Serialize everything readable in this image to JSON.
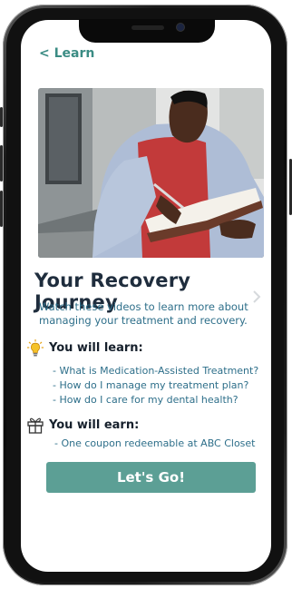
{
  "nav": {
    "back_label": "< Learn"
  },
  "content": {
    "title": "Your Recovery Journey",
    "subtitle": "Watch these videos to learn more about managing your treatment and recovery.",
    "learn": {
      "heading": "You will learn:",
      "icon": "lightbulb-icon",
      "items": [
        "- What is Medication-Assisted Treatment?",
        "- How do I manage my treatment plan?",
        "- How do I care for my dental health?"
      ]
    },
    "earn": {
      "heading": "You will earn:",
      "icon": "gift-icon",
      "items": [
        "- One coupon redeemable at ABC Closet"
      ]
    },
    "cta_label": "Let's Go!"
  },
  "colors": {
    "accent": "#3b8c84",
    "button": "#5c9f95",
    "title": "#1f2d3d",
    "body_text": "#2e6f8a"
  }
}
